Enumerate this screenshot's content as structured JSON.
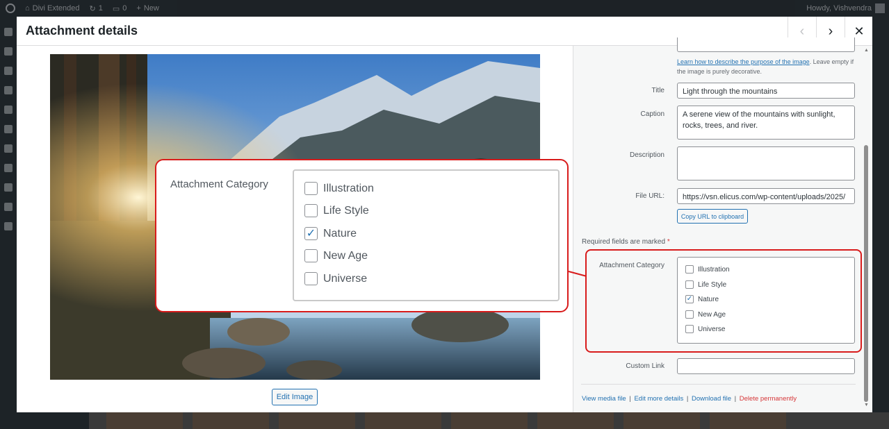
{
  "admin_bar": {
    "site_name": "Divi Extended",
    "updates_count": "1",
    "comments_count": "0",
    "new_label": "New",
    "greeting": "Howdy, Vishvendra"
  },
  "modal": {
    "title": "Attachment details",
    "prev_icon": "chevron-left-icon",
    "next_icon": "chevron-right-icon",
    "close_icon": "close-icon"
  },
  "image": {
    "description": "Light through the mountains",
    "edit_button": "Edit Image"
  },
  "details": {
    "alt_help_link": "Learn how to describe the purpose of the image",
    "alt_help_text": ". Leave empty if the image is purely decorative.",
    "title_label": "Title",
    "title_value": "Light through the mountains",
    "caption_label": "Caption",
    "caption_value": "A serene view of the mountains with sunlight, rocks, trees, and river.",
    "description_label": "Description",
    "description_value": "",
    "file_url_label": "File URL:",
    "file_url_value": "https://vsn.elicus.com/wp-content/uploads/2025/",
    "copy_url_button": "Copy URL to clipboard",
    "required_note": "Required fields are marked",
    "required_star": "*",
    "category_label": "Attachment Category",
    "categories": [
      {
        "label": "Illustration",
        "checked": false
      },
      {
        "label": "Life Style",
        "checked": false
      },
      {
        "label": "Nature",
        "checked": true
      },
      {
        "label": "New Age",
        "checked": false
      },
      {
        "label": "Universe",
        "checked": false
      }
    ],
    "custom_link_label": "Custom Link",
    "custom_link_value": ""
  },
  "footer": {
    "view_media": "View media file",
    "edit_more": "Edit more details",
    "download": "Download file",
    "delete": "Delete permanently",
    "separator": "|"
  },
  "colors": {
    "highlight": "#d81b1b",
    "link": "#2271b1",
    "delete": "#d63638"
  }
}
